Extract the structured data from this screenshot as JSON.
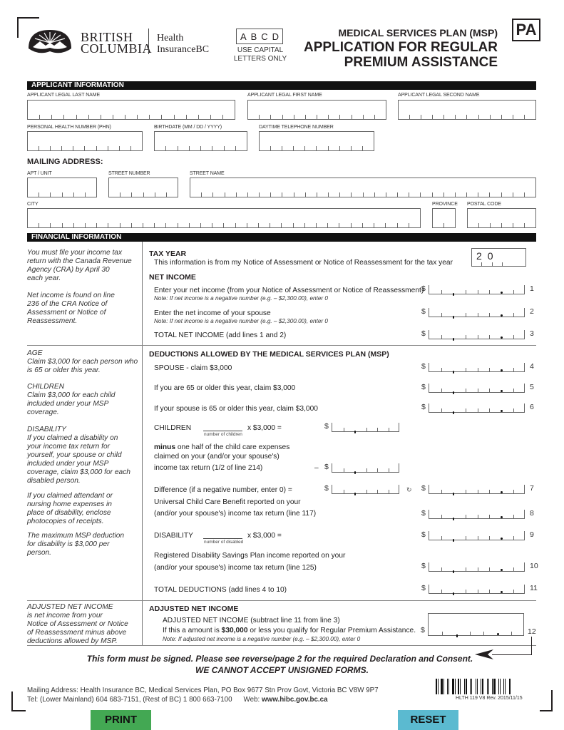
{
  "header": {
    "logo_line1": "BRITISH",
    "logo_line2": "COLUMBIA",
    "logo_dept1": "Health",
    "logo_dept2": "InsuranceBC",
    "caps_example": [
      "A",
      "B",
      "C",
      "D"
    ],
    "caps_note_line1": "USE CAPITAL",
    "caps_note_line2": "LETTERS ONLY",
    "program": "MEDICAL SERVICES PLAN (MSP)",
    "title_line1": "APPLICATION FOR REGULAR",
    "title_line2": "PREMIUM ASSISTANCE",
    "form_code": "PA"
  },
  "applicant": {
    "section_title": "APPLICANT INFORMATION",
    "last_name_label": "APPLICANT LEGAL LAST NAME",
    "first_name_label": "APPLICANT LEGAL FIRST NAME",
    "second_name_label": "APPLICANT LEGAL SECOND NAME",
    "phn_label": "PERSONAL HEALTH NUMBER (PHN)",
    "birthdate_label": "BIRTHDATE (MM / DD / YYYY)",
    "phone_label": "DAYTIME TELEPHONE NUMBER",
    "last_name": "",
    "first_name": "",
    "second_name": "",
    "phn": "",
    "birthdate": "",
    "phone": ""
  },
  "mailing": {
    "heading": "MAILING ADDRESS:",
    "apt_label": "APT / UNIT",
    "street_number_label": "STREET NUMBER",
    "street_name_label": "STREET NAME",
    "city_label": "CITY",
    "province_label": "PROVINCE",
    "postal_label": "POSTAL CODE",
    "apt": "",
    "street_number": "",
    "street_name": "",
    "city": "",
    "province": "",
    "postal": ""
  },
  "financial": {
    "section_title": "FINANCIAL INFORMATION",
    "side_notes": {
      "income_1": [
        "You must file your income tax",
        "return with the Canada Revenue",
        "Agency (CRA) by April 30",
        "each year."
      ],
      "income_2": [
        "Net income is found on line",
        "236 of the CRA Notice of",
        "Assessment or Notice of",
        "Reassessment."
      ],
      "age": [
        "AGE",
        "Claim $3,000 for each person who",
        "is 65 or older this year."
      ],
      "children": [
        "CHILDREN",
        "Claim $3,000 for each child",
        "included under your MSP",
        "coverage."
      ],
      "disability": [
        "DISABILITY",
        "If you claimed a disability on",
        "your income tax return for",
        "yourself, your spouse or child",
        "included under your MSP",
        "coverage, claim $3,000 for each",
        "disabled person."
      ],
      "attendant": [
        "If you claimed attendant or",
        "nursing home expenses in",
        "place of disability, enclose",
        "photocopies of receipts."
      ],
      "max": [
        "The maximum MSP deduction",
        "for disability is $3,000 per",
        "person."
      ],
      "adjusted": [
        "ADJUSTED NET INCOME",
        "is net income from your",
        "Notice of Assessment or Notice",
        "of Reassessment minus above",
        "deductions allowed by MSP."
      ]
    },
    "tax_year_heading": "TAX YEAR",
    "tax_year_text": "This information is from my Notice of Assessment or Notice of Reassessment for the tax year",
    "tax_year_prefix": "20",
    "net_income_heading": "NET INCOME",
    "line1_text": "Enter your net income (from your Notice of Assessment or Notice of Reassessment)",
    "negative_note": "Note: If net income is a negative number (e.g. – $2,300.00), enter 0",
    "line2_text": "Enter the net income of your spouse",
    "line3_text": "TOTAL NET INCOME  (add lines 1 and 2)",
    "deductions_heading": "DEDUCTIONS ALLOWED BY THE MEDICAL SERVICES PLAN (MSP)",
    "line4_text": "SPOUSE - claim $3,000",
    "line5_text": "If you are 65 or older this year, claim $3,000",
    "line6_text": "If your spouse is 65 or older this year, claim $3,000",
    "children_label": "CHILDREN",
    "children_sub": "number of children",
    "times_3000": "x $3,000  =",
    "minus_bold": "minus",
    "minus_text1": " one half of the child care expenses",
    "minus_text2": "claimed on your (and/or your spouse's)",
    "minus_text3": "income tax return (1/2 of line 214)",
    "minus_sign": "–",
    "difference_text": "Difference (if a negative number, enter 0) =",
    "arrow_glyph": "↻",
    "uccb_text1": "Universal Child Care Benefit reported on your",
    "uccb_text2": "(and/or your spouse's) income tax return (line 117)",
    "disability_label": "DISABILITY",
    "disability_sub": "number of disabled",
    "times_3000b": "x $3,000 =",
    "rdsp_text1": "Registered Disability Savings Plan income reported on your",
    "rdsp_text2": "(and/or your spouse's) income tax return (line 125)",
    "line11_text": "TOTAL DEDUCTIONS (add lines 4 to 10)",
    "adjusted_heading": "ADJUSTED NET INCOME",
    "line12_text1": "ADJUSTED NET INCOME (subtract line 11 from line 3)",
    "line12_pre": "If this a amount is ",
    "line12_bold": "$30,000",
    "line12_post": " or less you qualify for Regular Premium Assistance.",
    "line12_note": "Note: If adjusted net income is a negative number (e.g. – $2,300.00), enter 0",
    "dollar": "$",
    "line_numbers": [
      "1",
      "2",
      "3",
      "4",
      "5",
      "6",
      "7",
      "8",
      "9",
      "10",
      "11",
      "12"
    ]
  },
  "signature": {
    "line1": "This form must be signed. Please see reverse/page 2 for the required Declaration and Consent.",
    "line2": "WE CANNOT ACCEPT UNSIGNED FORMS."
  },
  "footer": {
    "address": "Mailing Address: Health Insurance BC, Medical Services Plan, PO Box 9677 Stn Prov Govt, Victoria BC  V8W 9P7",
    "tel": "Tel: (Lower Mainland) 604 683-7151, (Rest of BC) 1 800 663-7100",
    "web_label": "Web: ",
    "web_url": "www.hibc.gov.bc.ca",
    "form_id": "HLTH 119  V8  Rev. 2015/11/15"
  },
  "buttons": {
    "print": "PRINT",
    "reset": "RESET",
    "print_color": "#43a853",
    "reset_color": "#5bbad0"
  }
}
